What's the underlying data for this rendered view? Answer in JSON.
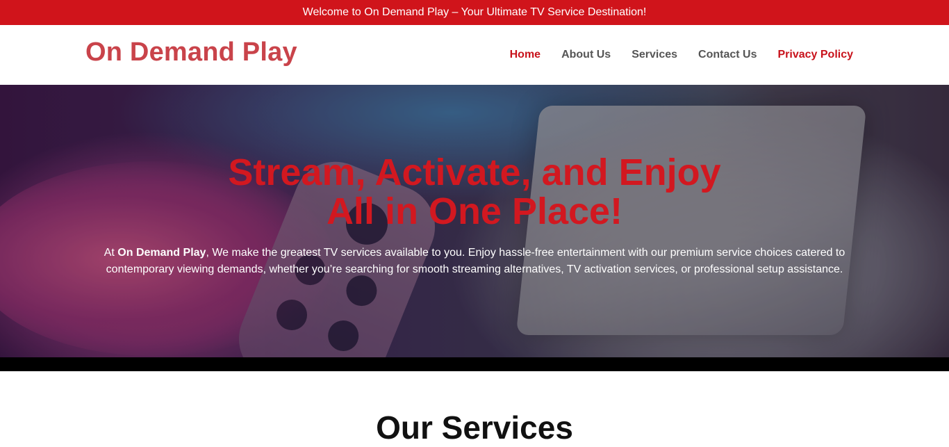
{
  "topbar": {
    "text": "Welcome to On Demand Play – Your Ultimate TV Service Destination!"
  },
  "header": {
    "logo": "On Demand Play",
    "nav": [
      {
        "label": "Home",
        "active": true
      },
      {
        "label": "About Us"
      },
      {
        "label": "Services"
      },
      {
        "label": "Contact Us"
      },
      {
        "label": "Privacy Policy",
        "highlight": true
      }
    ]
  },
  "hero": {
    "title_line1": "Stream, Activate, and Enjoy",
    "title_line2": "All in One Place!",
    "text_prefix": "At ",
    "text_brand": "On Demand Play",
    "text_body": ", We make the greatest TV services available to you. Enjoy hassle-free entertainment with our premium service choices catered to contemporary viewing demands, whether you’re searching for smooth streaming alternatives, TV activation services, or professional setup assistance."
  },
  "services": {
    "title": "Our Services"
  },
  "colors": {
    "brand_red": "#d0141b",
    "logo_red": "#c9434a"
  }
}
